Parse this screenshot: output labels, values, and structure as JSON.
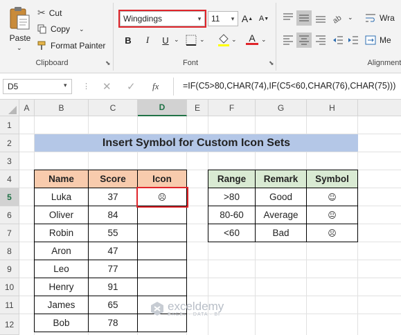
{
  "ribbon": {
    "clipboard": {
      "paste_label": "Paste",
      "cut_label": "Cut",
      "copy_label": "Copy",
      "format_painter_label": "Format Painter",
      "group_label": "Clipboard"
    },
    "font": {
      "font_name": "Wingdings",
      "font_size": "11",
      "bold": "B",
      "italic": "I",
      "underline": "U",
      "grow": "A",
      "shrink": "A",
      "font_color_letter": "A",
      "group_label": "Font"
    },
    "alignment": {
      "wrap_label": "Wra",
      "merge_label": "Me",
      "group_label": "Alignment"
    }
  },
  "formula_bar": {
    "name_box": "D5",
    "fx": "fx",
    "formula": "=IF(C5>80,CHAR(74),IF(C5<60,CHAR(76),CHAR(75)))"
  },
  "sheet": {
    "columns": [
      "A",
      "B",
      "C",
      "D",
      "E",
      "F",
      "G",
      "H"
    ],
    "rows": [
      "1",
      "2",
      "3",
      "4",
      "5",
      "6",
      "7",
      "8",
      "9",
      "10",
      "11",
      "12"
    ],
    "title": "Insert Symbol for Custom Icon Sets",
    "main_table": {
      "headers": [
        "Name",
        "Score",
        "Icon"
      ],
      "rows": [
        {
          "name": "Luka",
          "score": "37",
          "icon": "☹"
        },
        {
          "name": "Oliver",
          "score": "84",
          "icon": ""
        },
        {
          "name": "Robin",
          "score": "55",
          "icon": ""
        },
        {
          "name": "Aron",
          "score": "47",
          "icon": ""
        },
        {
          "name": "Leo",
          "score": "77",
          "icon": ""
        },
        {
          "name": "Henry",
          "score": "91",
          "icon": ""
        },
        {
          "name": "James",
          "score": "65",
          "icon": ""
        },
        {
          "name": "Bob",
          "score": "78",
          "icon": ""
        }
      ]
    },
    "symbol_table": {
      "headers": [
        "Range",
        "Remark",
        "Symbol"
      ],
      "rows": [
        {
          "range": ">80",
          "remark": "Good",
          "symbol": "☺"
        },
        {
          "range": "80-60",
          "remark": "Average",
          "symbol": "😐"
        },
        {
          "range": "<60",
          "remark": "Bad",
          "symbol": "☹"
        }
      ]
    }
  },
  "watermark": {
    "brand": "exceldemy",
    "tagline": "EXCEL · DATA · BI"
  },
  "colors": {
    "accent_green": "#217346",
    "highlight_red": "#e0252b",
    "title_fill": "#b4c7e7",
    "header_orange": "#f8cbad",
    "header_green": "#d9ead3"
  }
}
